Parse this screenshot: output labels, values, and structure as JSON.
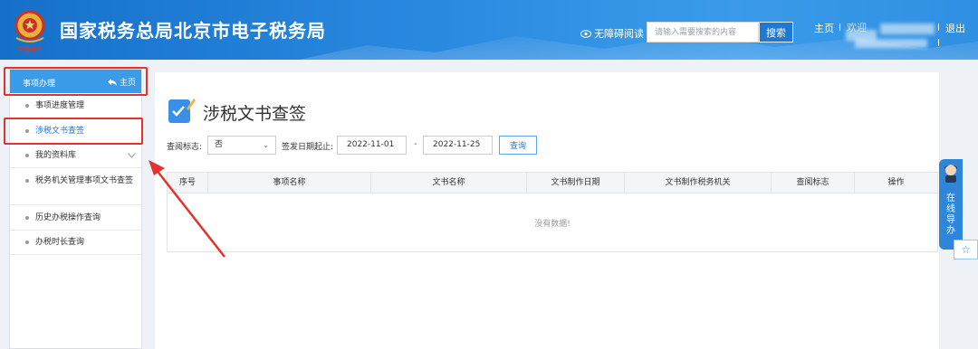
{
  "header": {
    "emblem_caption": "中国税务",
    "title": "国家税务总局北京市电子税务局",
    "accessible_reading": "无障碍阅读",
    "search_placeholder": "请输入需要搜索的内容",
    "search_button": "搜索",
    "home_link": "主页",
    "welcome": "欢迎",
    "logout": "退出"
  },
  "sidebar": {
    "header_label": "事项办理",
    "home_label": "主页",
    "items": [
      {
        "label": "事项进度管理"
      },
      {
        "label": "涉税文书查签"
      },
      {
        "label": "我的资料库"
      },
      {
        "label": "税务机关管理事项文书查签"
      },
      {
        "label": "历史办税操作查询"
      },
      {
        "label": "办税时长查询"
      }
    ]
  },
  "main": {
    "page_title": "涉税文书查签",
    "filter": {
      "read_flag_label": "查阅标志:",
      "read_flag_value": "否",
      "date_label": "签发日期起止:",
      "date_from": "2022-11-01",
      "date_to": "2022-11-25",
      "query_button": "查询"
    },
    "table": {
      "columns": [
        "序号",
        "事项名称",
        "文书名称",
        "文书制作日期",
        "文书制作税务机关",
        "查阅标志",
        "操作"
      ],
      "empty_text": "没有数据!"
    }
  },
  "floating": {
    "online_help": "在线导办"
  },
  "colors": {
    "header_blue": "#2a8ae0",
    "sidebar_active": "#1f79d4",
    "annotation_red": "#e5322d"
  }
}
